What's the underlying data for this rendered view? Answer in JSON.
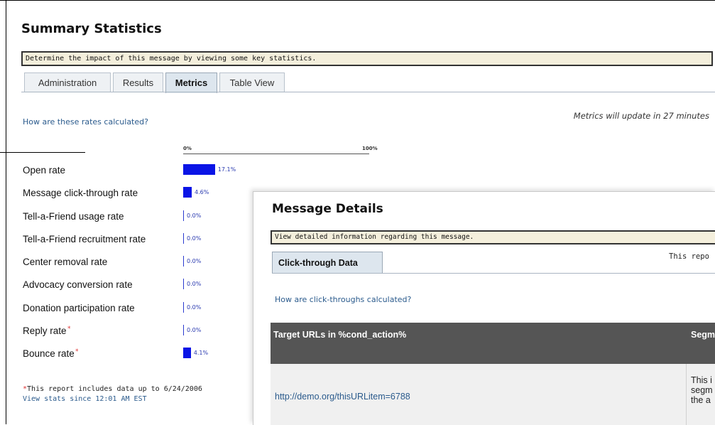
{
  "page": {
    "title": "Summary Statistics",
    "description": "Determine the impact of this message by viewing some key statistics."
  },
  "tabs": [
    {
      "label": "Administration",
      "active": false
    },
    {
      "label": "Results",
      "active": false
    },
    {
      "label": "Metrics",
      "active": true
    },
    {
      "label": "Table View",
      "active": false
    }
  ],
  "metrics": {
    "rates_link": "How are these rates calculated?",
    "update_note": "Metrics will update in 27 minutes",
    "scale_min": "0%",
    "scale_max": "100%",
    "bar_color": "#0a14e6",
    "rows": [
      {
        "label": "Open rate",
        "value": 17.1,
        "display": "17.1%",
        "asterisk": false
      },
      {
        "label": "Message click-through rate",
        "value": 4.6,
        "display": "4.6%",
        "asterisk": false
      },
      {
        "label": "Tell-a-Friend usage rate",
        "value": 0.0,
        "display": "0.0%",
        "asterisk": false
      },
      {
        "label": "Tell-a-Friend recruitment rate",
        "value": 0.0,
        "display": "0.0%",
        "asterisk": false
      },
      {
        "label": "Center removal rate",
        "value": 0.0,
        "display": "0.0%",
        "asterisk": false
      },
      {
        "label": "Advocacy conversion rate",
        "value": 0.0,
        "display": "0.0%",
        "asterisk": false
      },
      {
        "label": "Donation participation rate",
        "value": 0.0,
        "display": "0.0%",
        "asterisk": false
      },
      {
        "label": "Reply rate",
        "value": 0.0,
        "display": "0.0%",
        "asterisk": true
      },
      {
        "label": "Bounce rate",
        "value": 4.1,
        "display": "4.1%",
        "asterisk": true
      }
    ],
    "footnote": "This report includes data up to 6/24/2006",
    "footnote_star": "*",
    "stats_link": "View stats since 12:01 AM EST"
  },
  "message_details": {
    "title": "Message Details",
    "description": "View detailed information regarding this message.",
    "tab_label": "Click-through Data",
    "report_note": "This repo",
    "link": "How are click-throughs calculated?",
    "table": {
      "headers": [
        "Target URLs in %cond_action%",
        "Segme"
      ],
      "rows": [
        {
          "url": "http://demo.org/thisURLitem=6788",
          "segment_lines": [
            "This i",
            "segm",
            "the a"
          ]
        }
      ]
    }
  }
}
